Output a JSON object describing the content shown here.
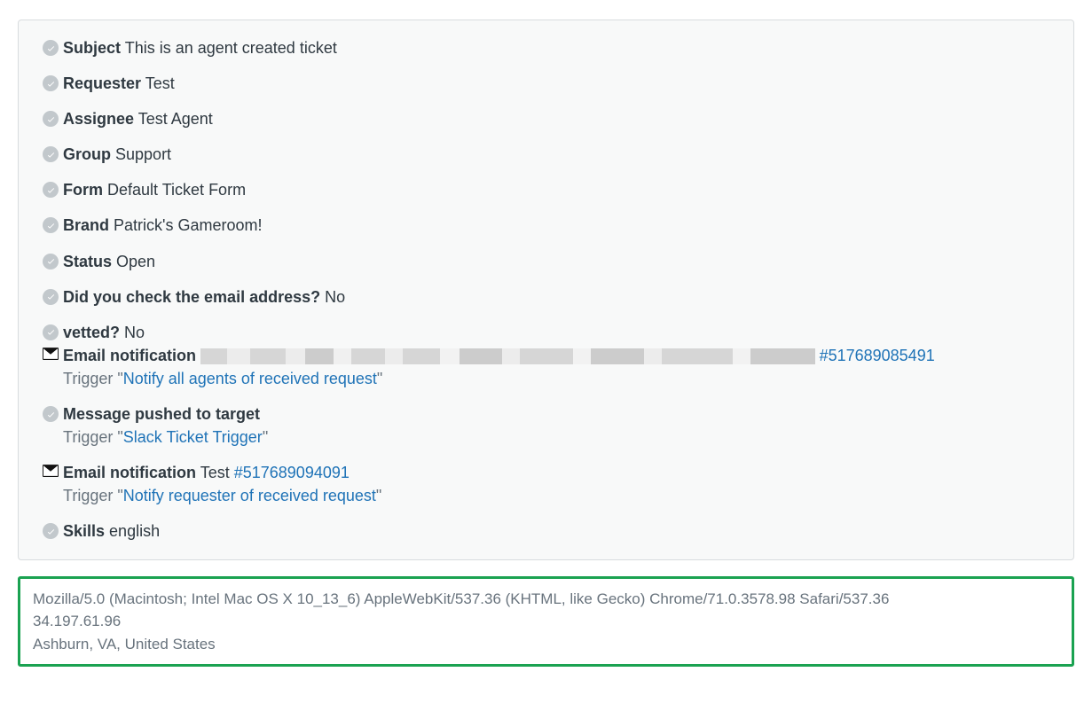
{
  "panel": {
    "items": [
      {
        "label": "Subject",
        "value": "This is an agent created ticket"
      },
      {
        "label": "Requester",
        "value": "Test"
      },
      {
        "label": "Assignee",
        "value": "Test Agent"
      },
      {
        "label": "Group",
        "value": "Support"
      },
      {
        "label": "Form",
        "value": "Default Ticket Form"
      },
      {
        "label": "Brand",
        "value": "Patrick's Gameroom!"
      },
      {
        "label": "Status",
        "value": "Open"
      },
      {
        "label": "Did you check the email address?",
        "value": "No"
      },
      {
        "label": "vetted?",
        "value": "No"
      }
    ],
    "email1": {
      "label": "Email notification",
      "idlink": "#517689085491",
      "trigger_prefix": "Trigger \"",
      "trigger_link": "Notify all agents of received request",
      "trigger_suffix": "\""
    },
    "push": {
      "label": "Message pushed to target",
      "trigger_prefix": "Trigger \"",
      "trigger_link": "Slack Ticket Trigger",
      "trigger_suffix": "\""
    },
    "email2": {
      "label": "Email notification",
      "value": "Test",
      "idlink": "#517689094091",
      "trigger_prefix": "Trigger \"",
      "trigger_link": "Notify requester of received request",
      "trigger_suffix": "\""
    },
    "skills": {
      "label": "Skills",
      "value": "english"
    }
  },
  "footer": {
    "line1": "Mozilla/5.0 (Macintosh; Intel Mac OS X 10_13_6) AppleWebKit/537.36 (KHTML, like Gecko) Chrome/71.0.3578.98 Safari/537.36",
    "line2": "34.197.61.96",
    "line3": "Ashburn, VA, United States"
  }
}
